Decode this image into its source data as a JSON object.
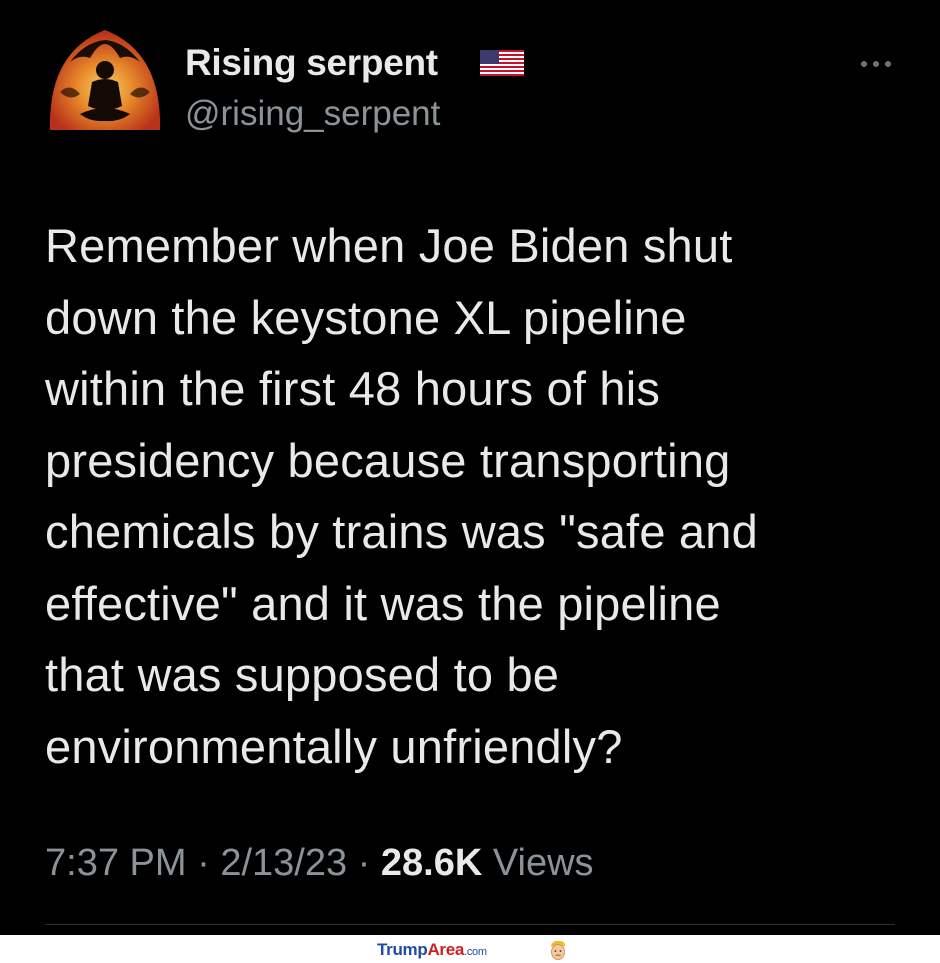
{
  "tweet": {
    "display_name": "Rising serpent",
    "handle": "@rising_serpent",
    "flag_icon": "us-flag-icon",
    "avatar_icon": "meditating-figure-avatar",
    "more_icon": "more-options-icon",
    "text": "Remember when Joe Biden shut\ndown the keystone XL pipeline\nwithin the first 48 hours of his\npresidency because transporting\nchemicals by trains was \"safe and\neffective\" and it was the pipeline\nthat was supposed to be\nenvironmentally unfriendly?",
    "time": "7:37 PM",
    "separator": "·",
    "date": "2/13/23",
    "views_count": "28.6K",
    "views_label": "Views"
  },
  "footer": {
    "brand_trump": "Trump",
    "brand_area": "Area",
    "brand_suffix": ".com",
    "mascot_icon": "trump-face-icon"
  },
  "colors": {
    "background": "#000000",
    "primary_text": "#e7e9ea",
    "secondary_text": "#8b9399",
    "brand_blue": "#1f4aa8",
    "brand_red": "#d11f1f"
  }
}
